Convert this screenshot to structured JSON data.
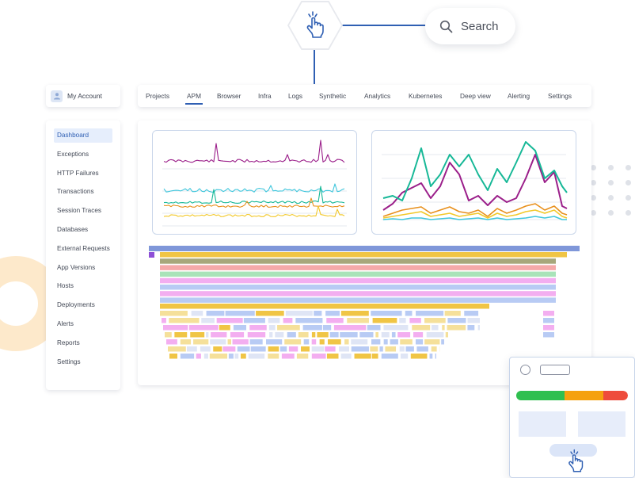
{
  "header": {
    "search_label": "Search",
    "pointer_icon": "hand-pointer-icon",
    "search_icon": "search-icon"
  },
  "account": {
    "label": "My Account",
    "icon": "user-icon"
  },
  "tabs": [
    {
      "label": "Projects",
      "active": false
    },
    {
      "label": "APM",
      "active": true
    },
    {
      "label": "Browser",
      "active": false
    },
    {
      "label": "Infra",
      "active": false
    },
    {
      "label": "Logs",
      "active": false
    },
    {
      "label": "Synthetic",
      "active": false
    },
    {
      "label": "Analytics",
      "active": false
    },
    {
      "label": "Kubernetes",
      "active": false
    },
    {
      "label": "Deep view",
      "active": false
    },
    {
      "label": "Alerting",
      "active": false
    },
    {
      "label": "Settings",
      "active": false
    }
  ],
  "sidebar": {
    "items": [
      {
        "label": "Dashboard",
        "active": true
      },
      {
        "label": "Exceptions",
        "active": false
      },
      {
        "label": "HTTP Failures",
        "active": false
      },
      {
        "label": "Transactions",
        "active": false
      },
      {
        "label": "Session Traces",
        "active": false
      },
      {
        "label": "Databases",
        "active": false
      },
      {
        "label": "External Requests",
        "active": false
      },
      {
        "label": "App Versions",
        "active": false
      },
      {
        "label": "Hosts",
        "active": false
      },
      {
        "label": "Deployments",
        "active": false
      },
      {
        "label": "Alerts",
        "active": false
      },
      {
        "label": "Reports",
        "active": false
      },
      {
        "label": "Settings",
        "active": false
      }
    ]
  },
  "colors": {
    "accent": "#2f5fb3",
    "purple": "#9b1f8a",
    "teal": "#17b897",
    "cyan": "#3fc6dc",
    "orange": "#e8901c",
    "yellow": "#f2c829",
    "status_green": "#2fbf4f",
    "status_orange": "#f5a10f",
    "status_red": "#ee4c3c"
  },
  "status_bar": [
    {
      "color": "#2fbf4f",
      "fraction": 0.43
    },
    {
      "color": "#f5a10f",
      "fraction": 0.35
    },
    {
      "color": "#ee4c3c",
      "fraction": 0.22
    }
  ]
}
